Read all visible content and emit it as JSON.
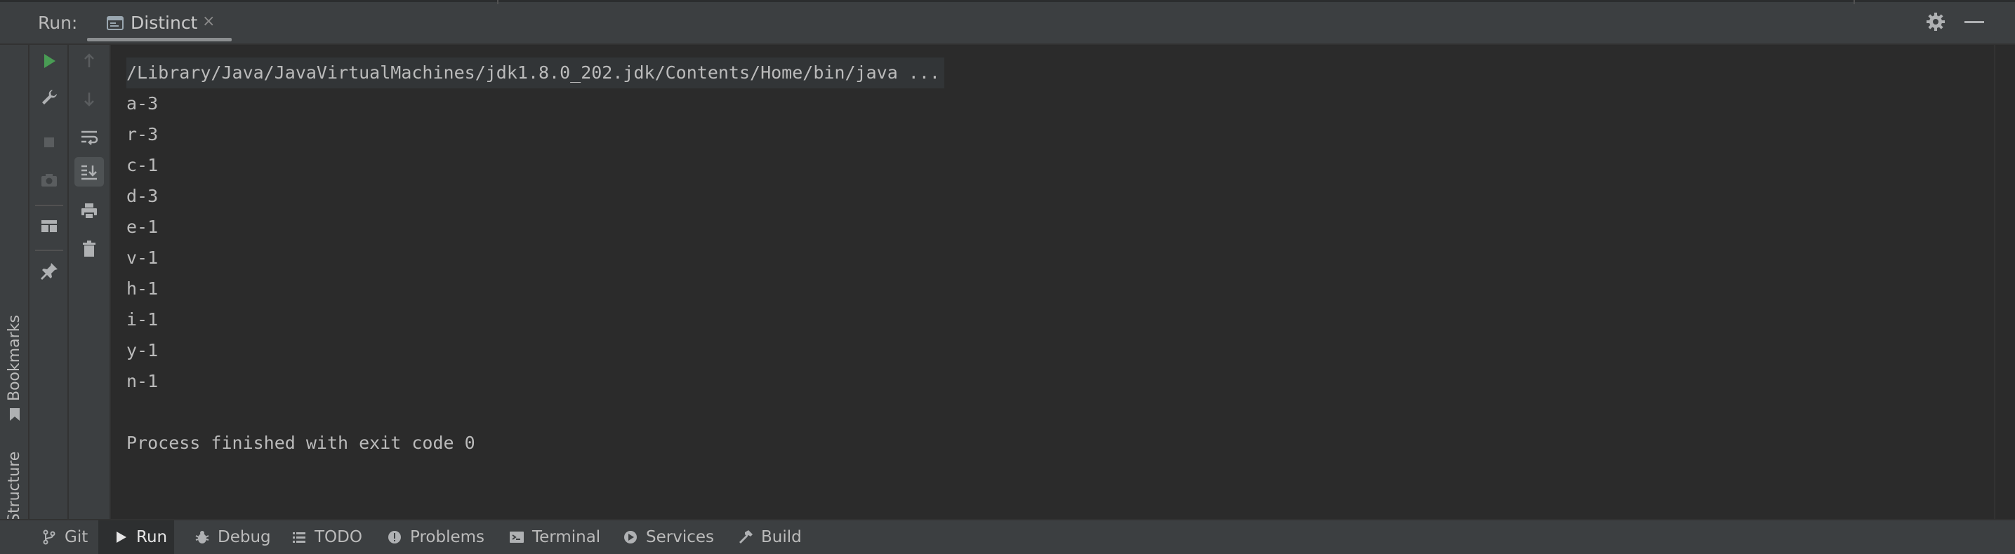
{
  "run_panel": {
    "label": "Run:",
    "tab": {
      "label": "Distinct",
      "close": "×"
    }
  },
  "side_stripe": {
    "bookmarks": "Bookmarks",
    "structure": "Structure"
  },
  "toolbar": {
    "col1": [
      "rerun-icon",
      "modify-config-icon",
      "stop-icon",
      "camera-icon",
      "layout-icon",
      "pin-icon"
    ],
    "col2": [
      "up-icon",
      "down-icon",
      "soft-wrap-icon",
      "scroll-to-end-icon",
      "print-icon",
      "trash-icon"
    ]
  },
  "console": {
    "command": "/Library/Java/JavaVirtualMachines/jdk1.8.0_202.jdk/Contents/Home/bin/java ...",
    "lines": [
      "a-3",
      "r-3",
      "c-1",
      "d-3",
      "e-1",
      "v-1",
      "h-1",
      "i-1",
      "y-1",
      "n-1"
    ],
    "exit_message": "Process finished with exit code 0"
  },
  "bottom_tabs": [
    {
      "label": "Git",
      "icon": "git-branch-icon"
    },
    {
      "label": "Run",
      "icon": "run-icon",
      "active": true
    },
    {
      "label": "Debug",
      "icon": "bug-icon"
    },
    {
      "label": "TODO",
      "icon": "list-icon"
    },
    {
      "label": "Problems",
      "icon": "alert-icon"
    },
    {
      "label": "Terminal",
      "icon": "terminal-icon"
    },
    {
      "label": "Services",
      "icon": "services-icon"
    },
    {
      "label": "Build",
      "icon": "hammer-icon"
    }
  ],
  "colors": {
    "accent_green": "#499c54",
    "background": "#2b2b2b",
    "panel": "#3c3f41",
    "text": "#bbbbbb"
  }
}
